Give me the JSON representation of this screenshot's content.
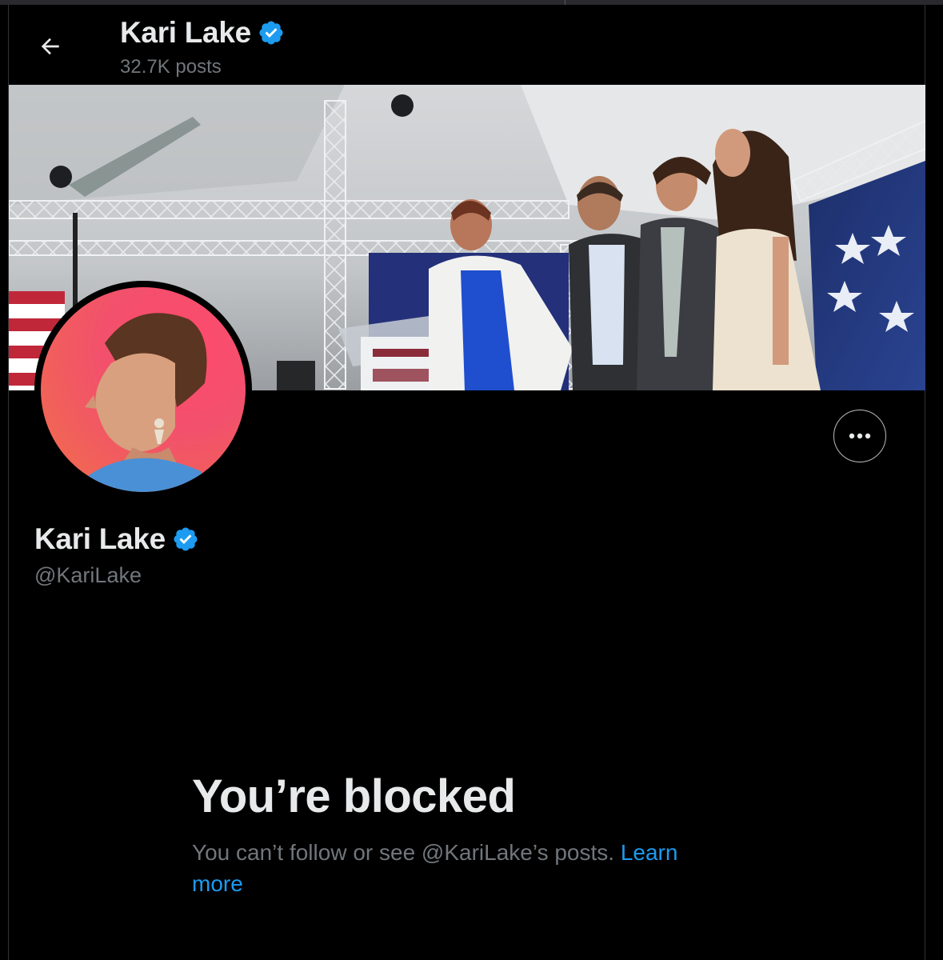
{
  "header": {
    "title": "Kari Lake",
    "posts_count": "32.7K posts"
  },
  "profile": {
    "display_name": "Kari Lake",
    "handle": "@KariLake",
    "verified": true
  },
  "blocked": {
    "title": "You’re blocked",
    "message": "You can’t follow or see @KariLake’s posts.",
    "learn_more": "Learn more"
  },
  "icons": {
    "back": "arrow-left-icon",
    "verified": "verified-badge-icon",
    "more": "more-horizontal-icon"
  },
  "colors": {
    "background": "#000000",
    "primary_text": "#e7e9ea",
    "secondary_text": "#71767b",
    "link": "#1d9bf0",
    "verified_badge": "#1d9bf0"
  }
}
